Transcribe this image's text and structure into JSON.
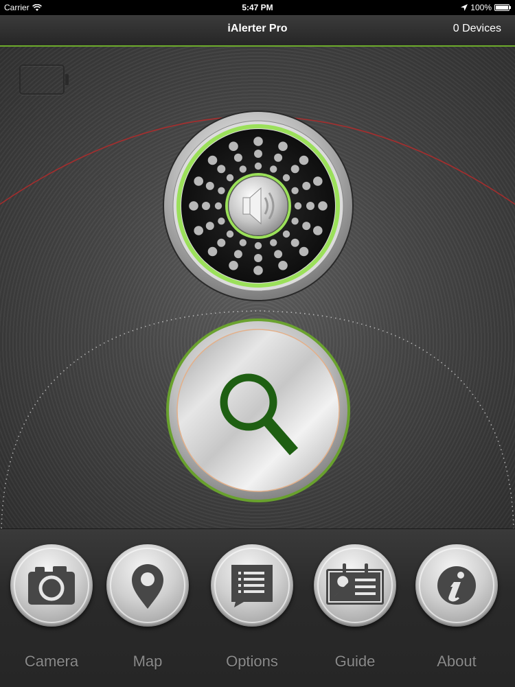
{
  "status_bar": {
    "carrier": "Carrier",
    "time": "5:47 PM",
    "battery_percent": "100%"
  },
  "nav_bar": {
    "title": "iAlerter Pro",
    "devices": "0 Devices"
  },
  "main": {
    "speaker_button": {
      "icon": "speaker-icon"
    },
    "find_button": {
      "icon": "magnifier-icon"
    },
    "accent_green": "#6dab2b",
    "arc_red": "#b52a2a"
  },
  "tab_bar": {
    "tabs": [
      {
        "label": "Camera",
        "icon": "camera-icon"
      },
      {
        "label": "Map",
        "icon": "map-pin-icon"
      },
      {
        "label": "Options",
        "icon": "list-icon"
      },
      {
        "label": "Guide",
        "icon": "guide-icon"
      },
      {
        "label": "About",
        "icon": "info-icon"
      }
    ]
  }
}
